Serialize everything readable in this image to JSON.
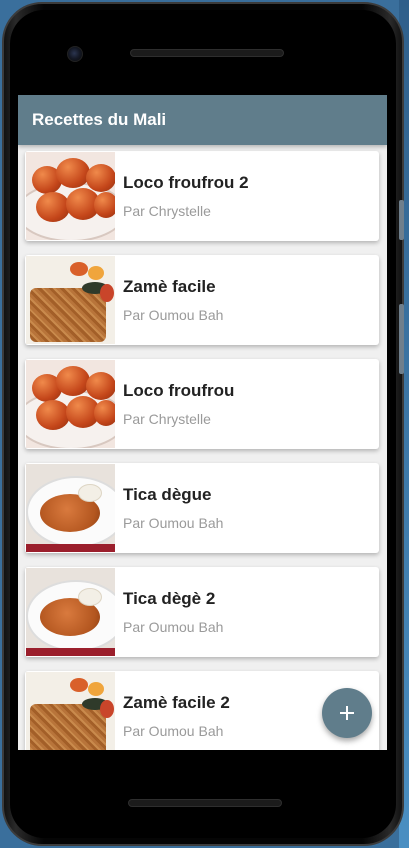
{
  "app": {
    "title": "Recettes du Mali"
  },
  "recipes": [
    {
      "title": "Loco froufrou 2",
      "author": "Par Chrystelle",
      "image": "fritters-photo"
    },
    {
      "title": "Zamè facile",
      "author": "Par Oumou Bah",
      "image": "rice-dish-photo"
    },
    {
      "title": "Loco froufrou",
      "author": "Par Chrystelle",
      "image": "fritters-photo"
    },
    {
      "title": "Tica dègue",
      "author": "Par Oumou Bah",
      "image": "stew-plate-photo"
    },
    {
      "title": "Tica dègè 2",
      "author": "Par Oumou Bah",
      "image": "stew-plate-photo"
    },
    {
      "title": "Zamè facile 2",
      "author": "Par Oumou Bah",
      "image": "rice-dish-photo"
    }
  ],
  "fab": {
    "icon": "plus-icon"
  },
  "colors": {
    "primary": "#607d8b",
    "background": "#f0f0f0",
    "card": "#ffffff",
    "title_text": "#222222",
    "subtitle_text": "#9a9a9a"
  }
}
